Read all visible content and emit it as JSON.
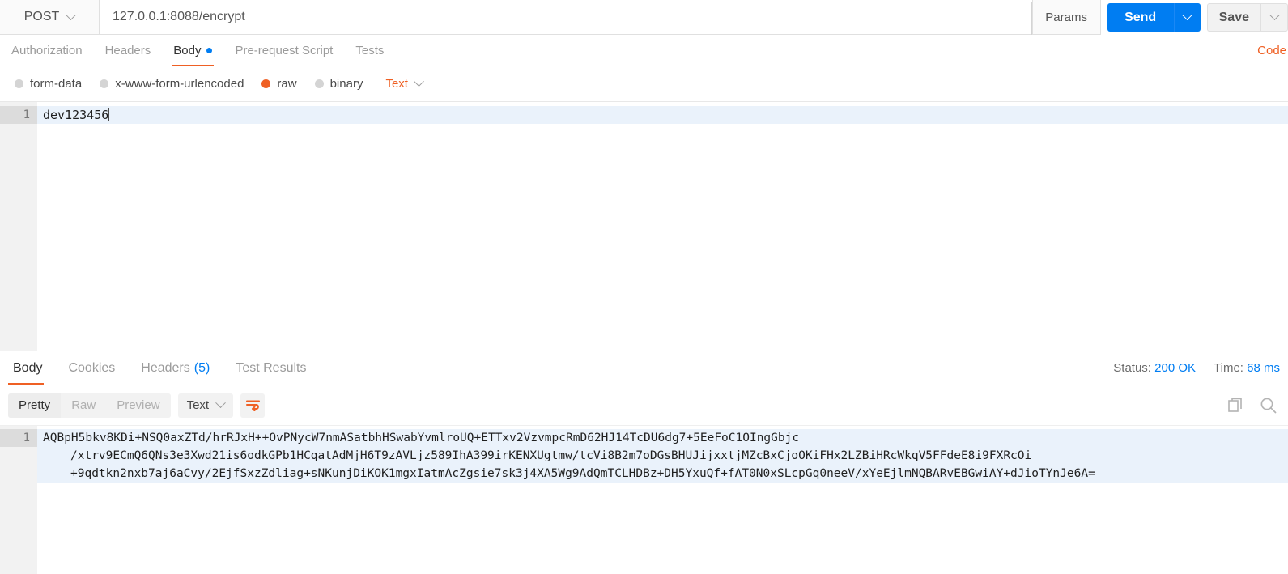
{
  "request": {
    "method": "POST",
    "url": "127.0.0.1:8088/encrypt",
    "params_label": "Params",
    "send_label": "Send",
    "save_label": "Save",
    "tabs": [
      {
        "label": "Authorization",
        "active": false,
        "dot": false
      },
      {
        "label": "Headers",
        "active": false,
        "dot": false
      },
      {
        "label": "Body",
        "active": true,
        "dot": true
      },
      {
        "label": "Pre-request Script",
        "active": false,
        "dot": false
      },
      {
        "label": "Tests",
        "active": false,
        "dot": false
      }
    ],
    "code_link": "Code",
    "body_types": [
      {
        "label": "form-data",
        "selected": false
      },
      {
        "label": "x-www-form-urlencoded",
        "selected": false
      },
      {
        "label": "raw",
        "selected": true
      },
      {
        "label": "binary",
        "selected": false
      }
    ],
    "raw_format": "Text",
    "editor": {
      "line_number": "1",
      "content": "dev123456"
    }
  },
  "response": {
    "tabs": [
      {
        "label": "Body",
        "active": true,
        "count": ""
      },
      {
        "label": "Cookies",
        "active": false,
        "count": ""
      },
      {
        "label": "Headers",
        "active": false,
        "count": "(5)"
      },
      {
        "label": "Test Results",
        "active": false,
        "count": ""
      }
    ],
    "status_label": "Status:",
    "status_value": "200 OK",
    "time_label": "Time:",
    "time_value": "68 ms",
    "view_modes": [
      {
        "label": "Pretty",
        "active": true
      },
      {
        "label": "Raw",
        "active": false
      },
      {
        "label": "Preview",
        "active": false
      }
    ],
    "format": "Text",
    "line_number": "1",
    "body_lines": [
      "AQBpH5bkv8KDi+NSQ0axZTd/hrRJxH++OvPNycW7nmASatbhHSwabYvmlroUQ+ETTxv2VzvmpcRmD62HJ14TcDU6dg7+5EeFoC1OIngGbjc",
      "/xtrv9ECmQ6QNs3e3Xwd21is6odkGPb1HCqatAdMjH6T9zAVLjz589IhA399irKENXUgtmw/tcVi8B2m7oDGsBHUJijxxtjMZcBxCjoOKiFHx2LZBiHRcWkqV5FFdeE8i9FXRcOi",
      "+9qdtkn2nxb7aj6aCvy/2EjfSxzZdliag+sNKunjDiKOK1mgxIatmAcZgsie7sk3j4XA5Wg9AdQmTCLHDBz+DH5YxuQf+fAT0N0xSLcpGq0neeV/xYeEjlmNQBARvEBGwiAY+dJioTYnJe6A="
    ]
  },
  "icons": {
    "chevron_down": "chevron-down-icon",
    "word_wrap": "word-wrap-icon",
    "copy": "copy-icon",
    "search": "search-icon"
  },
  "colors": {
    "accent_orange": "#ef6024",
    "accent_blue": "#007df2",
    "gutter_bg": "#f2f2f2",
    "highlight_line": "#eaf2fb"
  }
}
